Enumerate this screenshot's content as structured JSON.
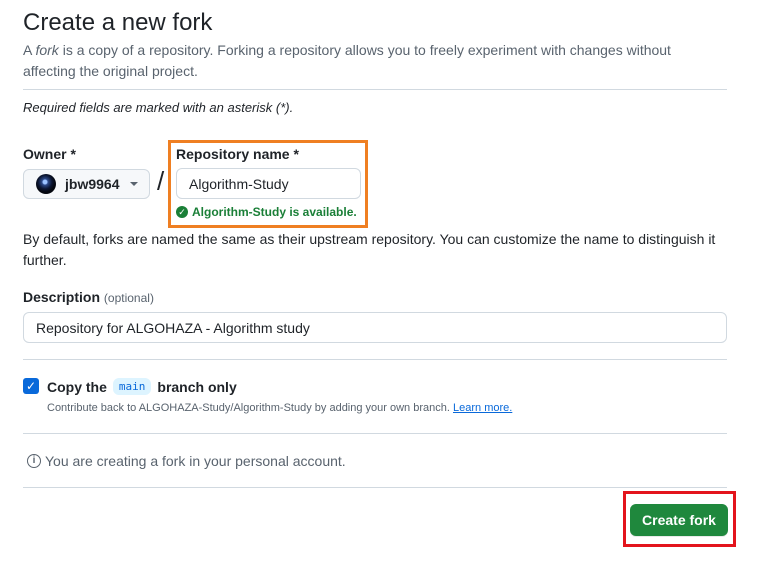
{
  "page": {
    "title": "Create a new fork",
    "intro_prefix": "A ",
    "intro_em": "fork",
    "intro_rest": " is a copy of a repository. Forking a repository allows you to freely experiment with changes without affecting the original project.",
    "required_note": "Required fields are marked with an asterisk (*)."
  },
  "owner": {
    "label": "Owner *",
    "value": "jbw9964"
  },
  "separator": "/",
  "repo": {
    "label": "Repository name *",
    "value": "Algorithm-Study",
    "availability": "Algorithm-Study is available."
  },
  "default_note": "By default, forks are named the same as their upstream repository. You can customize the name to distinguish it further.",
  "description": {
    "label": "Description",
    "optional": "(optional)",
    "value": "Repository for ALGOHAZA - Algorithm study"
  },
  "copy_branch": {
    "checked": true,
    "label_prefix": "Copy the",
    "branch": "main",
    "label_suffix": "branch only",
    "hint": "Contribute back to ALGOHAZA-Study/Algorithm-Study by adding your own branch.",
    "learn_more": "Learn more."
  },
  "info": {
    "text": "You are creating a fork in your personal account."
  },
  "actions": {
    "create_label": "Create fork"
  },
  "colors": {
    "accent_blue": "#0969da",
    "success_green": "#1a7f37",
    "button_green": "#1f883d",
    "orange_highlight": "#ef7f22",
    "red_highlight": "#e3141c"
  },
  "icons": {
    "owner_caret": "chevron-down-icon",
    "availability": "check-circle-icon",
    "checkbox": "checkmark-icon",
    "info": "info-icon"
  }
}
